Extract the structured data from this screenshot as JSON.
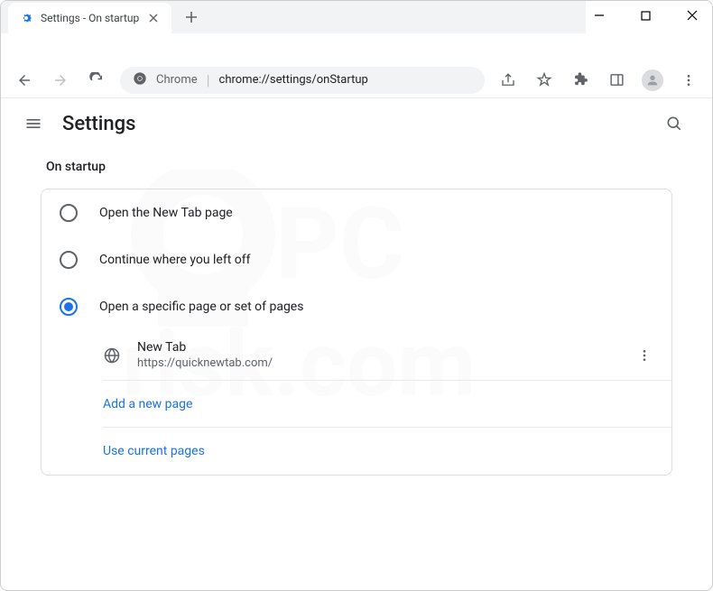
{
  "tab": {
    "title": "Settings - On startup"
  },
  "omnibox": {
    "app": "Chrome",
    "url": "chrome://settings/onStartup"
  },
  "header": {
    "title": "Settings"
  },
  "section": {
    "label": "On startup"
  },
  "options": [
    {
      "label": "Open the New Tab page",
      "selected": false
    },
    {
      "label": "Continue where you left off",
      "selected": false
    },
    {
      "label": "Open a specific page or set of pages",
      "selected": true
    }
  ],
  "page_entry": {
    "title": "New Tab",
    "url": "https://quicknewtab.com/"
  },
  "actions": {
    "add": "Add a new page",
    "use_current": "Use current pages"
  }
}
